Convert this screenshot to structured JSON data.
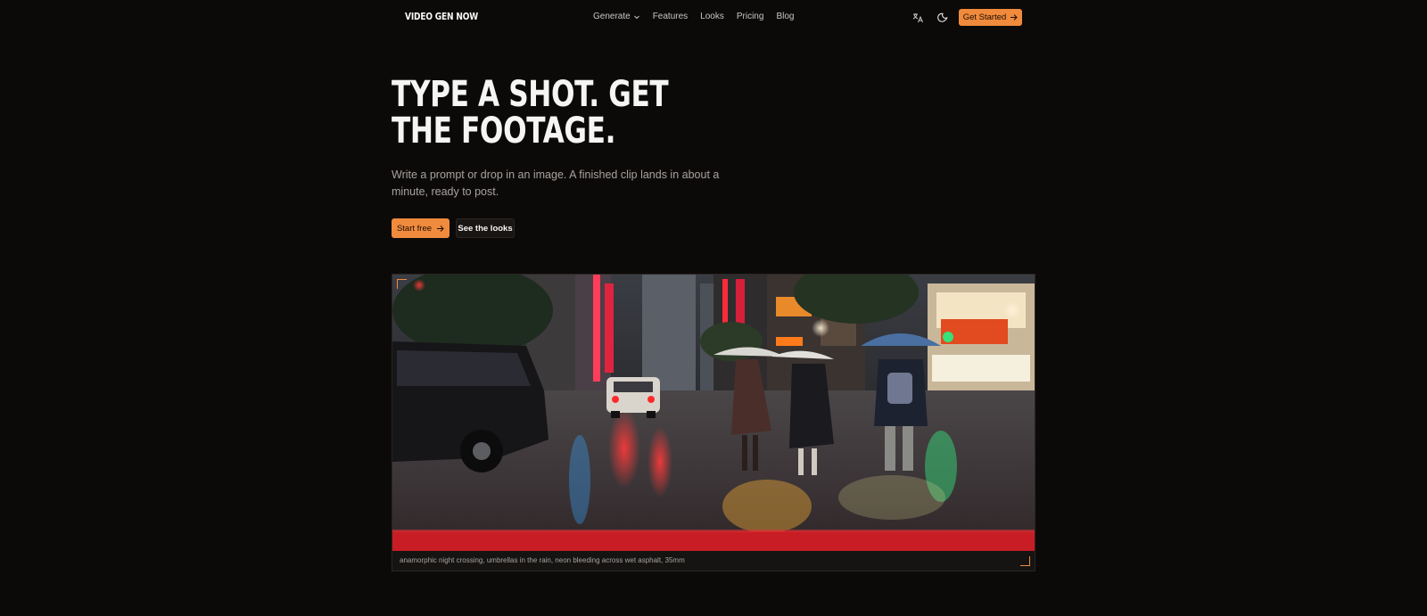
{
  "brand": {
    "logo_text": "VIDEO GEN NOW"
  },
  "nav": {
    "items": [
      {
        "label": "Generate",
        "has_dropdown": true
      },
      {
        "label": "Features"
      },
      {
        "label": "Looks"
      },
      {
        "label": "Pricing"
      },
      {
        "label": "Blog"
      }
    ],
    "icons": [
      "translate-icon",
      "moon-icon"
    ],
    "cta_label": "Get Started"
  },
  "hero": {
    "title": "TYPE A SHOT. GET THE FOOTAGE.",
    "subtitle": "Write a prompt or drop in an image. A finished clip lands in about a minute, ready to post.",
    "primary_label": "Start free",
    "secondary_label": "See the looks"
  },
  "preview": {
    "caption": "anamorphic night crossing, umbrellas in the rain, neon bleeding across wet asphalt, 35mm"
  },
  "colors": {
    "background": "#0c0a09",
    "accent": "#f08a3c",
    "text": "#f5f5f4",
    "muted": "#a8a29e"
  }
}
